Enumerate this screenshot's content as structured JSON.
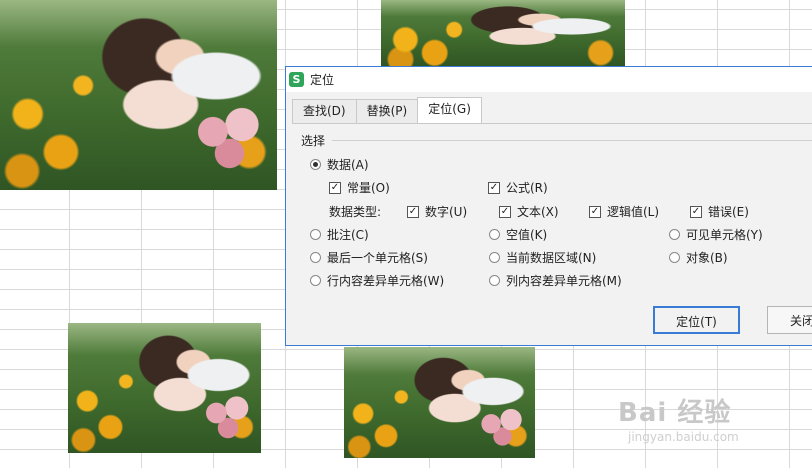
{
  "dialog": {
    "title": "定位",
    "app_icon": "S",
    "tabs": [
      {
        "label": "查找(D)"
      },
      {
        "label": "替换(P)"
      },
      {
        "label": "定位(G)",
        "active": true
      }
    ],
    "group_label": "选择",
    "options": {
      "data": {
        "label": "数据(A)",
        "selected": true
      },
      "constants": {
        "label": "常量(O)",
        "checked": true
      },
      "formulas": {
        "label": "公式(R)",
        "checked": true
      },
      "data_type_label": "数据类型:",
      "numbers": {
        "label": "数字(U)",
        "checked": true
      },
      "text": {
        "label": "文本(X)",
        "checked": true
      },
      "logicals": {
        "label": "逻辑值(L)",
        "checked": true
      },
      "errors": {
        "label": "错误(E)",
        "checked": true
      },
      "comments": {
        "label": "批注(C)",
        "selected": false
      },
      "blanks": {
        "label": "空值(K)",
        "selected": false
      },
      "visible_cells": {
        "label": "可见单元格(Y)",
        "selected": false
      },
      "last_cell": {
        "label": "最后一个单元格(S)",
        "selected": false
      },
      "current_region": {
        "label": "当前数据区域(N)",
        "selected": false
      },
      "objects": {
        "label": "对象(B)",
        "selected": false
      },
      "row_differences": {
        "label": "行内容差异单元格(W)",
        "selected": false
      },
      "column_differences": {
        "label": "列内容差异单元格(M)",
        "selected": false
      }
    },
    "buttons": {
      "goto": "定位(T)",
      "close": "关闭"
    }
  },
  "watermark": {
    "text": "Bai 经验",
    "sub": "jingyan.baidu.com"
  },
  "colors": {
    "accent": "#3a7bd5",
    "app_icon": "#2fa55b"
  }
}
